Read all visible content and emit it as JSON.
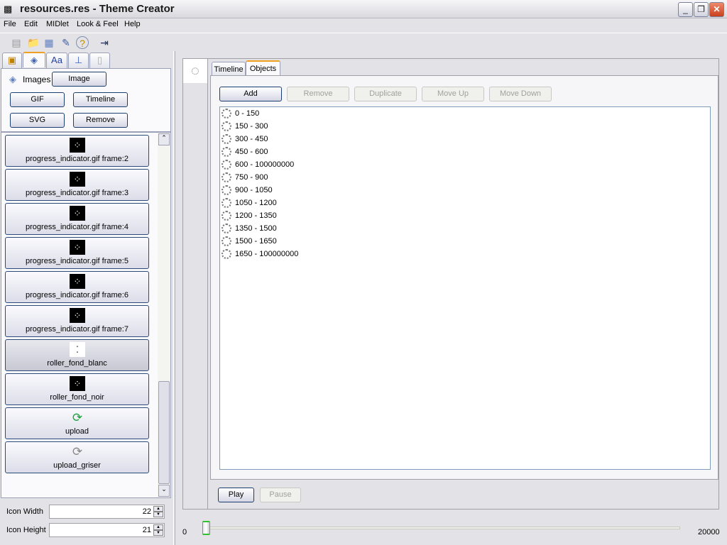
{
  "window": {
    "title": "resources.res - Theme Creator",
    "minimize": "_",
    "restore": "❐",
    "close": "✕"
  },
  "menu": [
    "File",
    "Edit",
    "MIDlet",
    "Look & Feel",
    "Help"
  ],
  "toolbar": [
    {
      "icon": "new-icon",
      "glyph": "▤"
    },
    {
      "icon": "open-folder-icon",
      "glyph": "📁"
    },
    {
      "icon": "save-icon",
      "glyph": "▦"
    },
    {
      "icon": "edit-icon",
      "glyph": "✎"
    },
    {
      "icon": "help-icon",
      "glyph": "?"
    },
    {
      "icon": "exit-icon",
      "glyph": "⇥"
    }
  ],
  "left": {
    "tabs": [
      {
        "icon": "themes-icon",
        "glyph": "▣"
      },
      {
        "icon": "images-icon",
        "glyph": "◈"
      },
      {
        "icon": "fonts-icon",
        "glyph": "Aa"
      },
      {
        "icon": "localization-pin-icon",
        "glyph": "⊥"
      },
      {
        "icon": "data-icon",
        "glyph": "▯"
      }
    ],
    "section_label": "Images",
    "buttons": {
      "image": "Image",
      "gif": "GIF",
      "timeline": "Timeline",
      "svg": "SVG",
      "remove": "Remove"
    },
    "items": [
      {
        "label": "progress_indicator.gif frame:2",
        "glyph": "⁘"
      },
      {
        "label": "progress_indicator.gif frame:3",
        "glyph": "⁘"
      },
      {
        "label": "progress_indicator.gif frame:4",
        "glyph": "⁘"
      },
      {
        "label": "progress_indicator.gif frame:5",
        "glyph": "⁘"
      },
      {
        "label": "progress_indicator.gif frame:6",
        "glyph": "⁘"
      },
      {
        "label": "progress_indicator.gif frame:7",
        "glyph": "⁘"
      },
      {
        "label": "roller_fond_blanc",
        "glyph": "⁚",
        "selected": true
      },
      {
        "label": "roller_fond_noir",
        "glyph": "⁘"
      },
      {
        "label": "upload",
        "glyph": "⟳"
      },
      {
        "label": "upload_griser",
        "glyph": "⟳"
      }
    ],
    "icon_width_label": "Icon Width",
    "icon_width": "22",
    "icon_height_label": "Icon Height",
    "icon_height": "21"
  },
  "right": {
    "tabs": [
      "Timeline",
      "Objects"
    ],
    "selected_tab": "Objects",
    "buttons": {
      "add": "Add",
      "remove": "Remove",
      "duplicate": "Duplicate",
      "move_up": "Move Up",
      "move_down": "Move Down"
    },
    "objects": [
      "0 - 150",
      "150 - 300",
      "300 - 450",
      "450 - 600",
      "600 - 100000000",
      "750 - 900",
      "900 - 1050",
      "1050 - 1200",
      "1200 - 1350",
      "1350 - 1500",
      "1500 - 1650",
      "1650 - 100000000"
    ],
    "play": "Play",
    "pause": "Pause",
    "slider": {
      "min": "0",
      "max": "20000",
      "value": 0
    }
  }
}
